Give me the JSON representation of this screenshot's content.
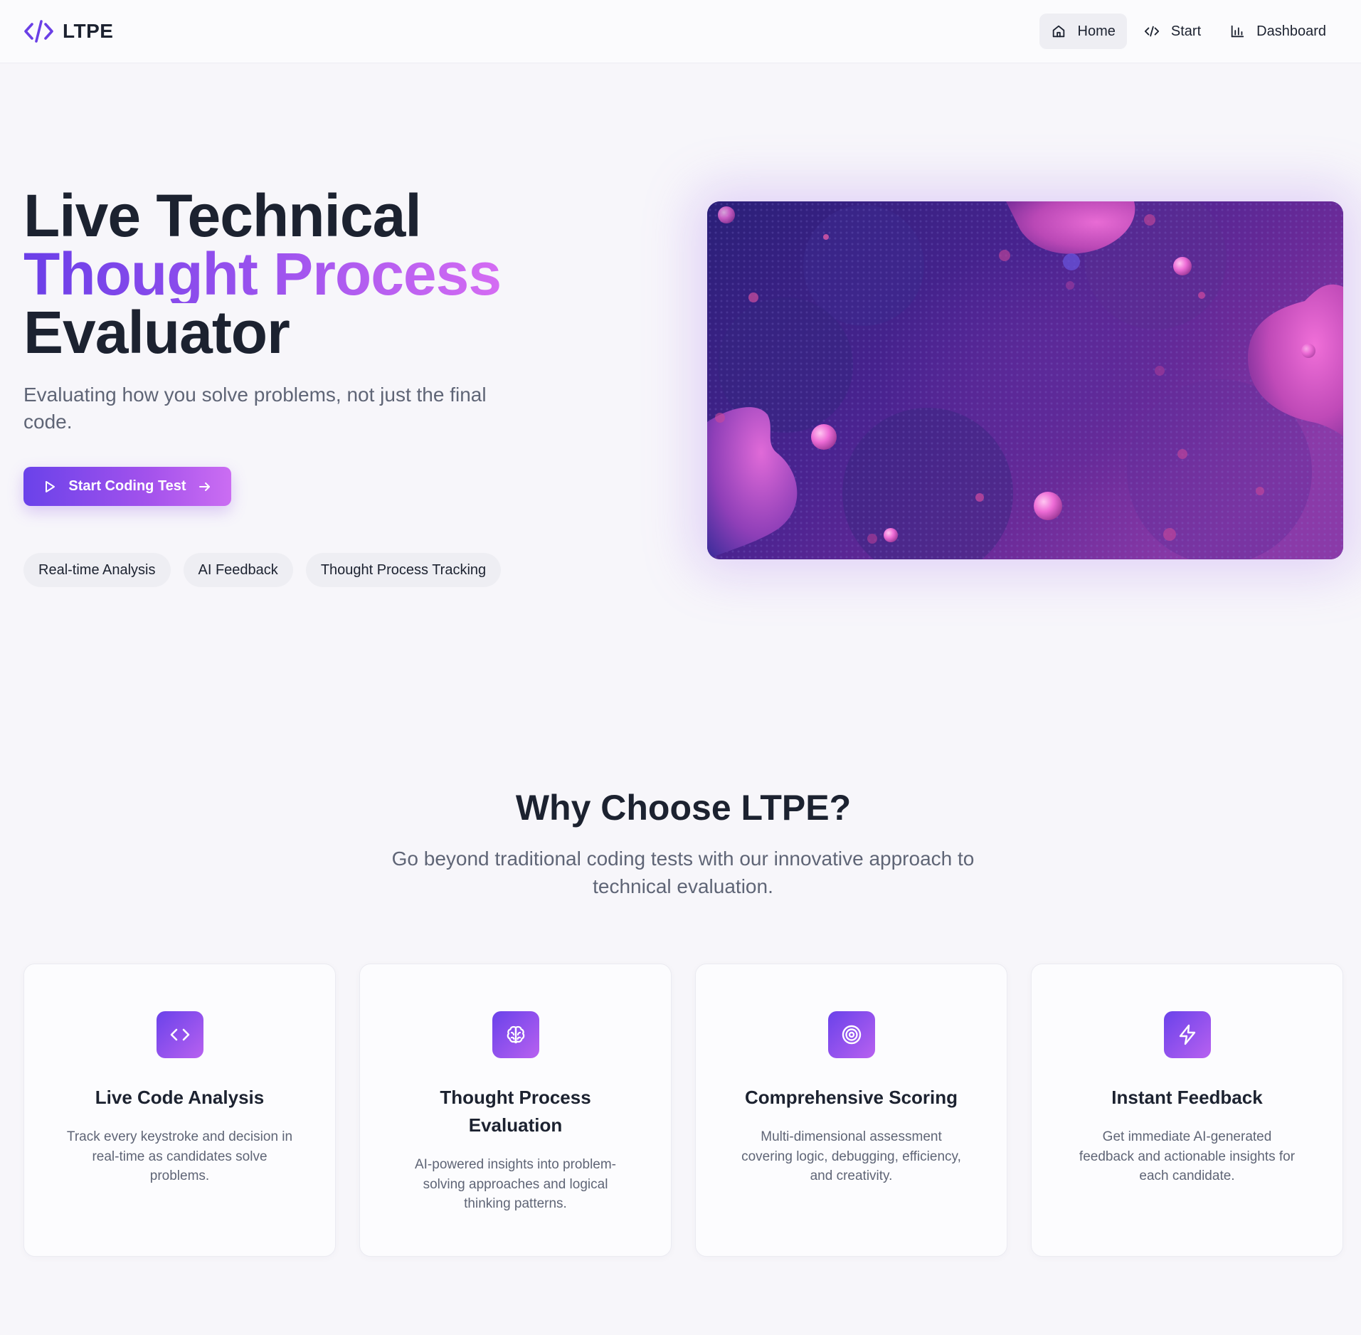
{
  "nav": {
    "brand": "LTPE",
    "links": [
      {
        "label": "Home",
        "icon": "home-icon",
        "active": true
      },
      {
        "label": "Start",
        "icon": "code-icon",
        "active": false
      },
      {
        "label": "Dashboard",
        "icon": "bar-chart-icon",
        "active": false
      }
    ]
  },
  "hero": {
    "title_line1": "Live Technical",
    "title_line2": "Thought Process",
    "title_line3": "Evaluator",
    "subtitle": "Evaluating how you solve problems, not just the final code.",
    "cta_label": "Start Coding Test",
    "tags": [
      "Real-time Analysis",
      "AI Feedback",
      "Thought Process Tracking"
    ]
  },
  "why": {
    "title": "Why Choose LTPE?",
    "subtitle": "Go beyond traditional coding tests with our innovative approach to technical evaluation.",
    "features": [
      {
        "icon": "code-icon",
        "title": "Live Code Analysis",
        "description": "Track every keystroke and decision in real-time as candidates solve problems."
      },
      {
        "icon": "brain-icon",
        "title": "Thought Process Evaluation",
        "description": "AI-powered insights into problem-solving approaches and logical thinking patterns."
      },
      {
        "icon": "target-icon",
        "title": "Comprehensive Scoring",
        "description": "Multi-dimensional assessment covering logic, debugging, efficiency, and creativity."
      },
      {
        "icon": "lightning-icon",
        "title": "Instant Feedback",
        "description": "Get immediate AI-generated feedback and actionable insights for each candidate."
      }
    ]
  },
  "colors": {
    "accent_start": "#6a42ea",
    "accent_end": "#cb6df2",
    "text_primary": "#1c2230",
    "text_secondary": "#5f6576"
  }
}
